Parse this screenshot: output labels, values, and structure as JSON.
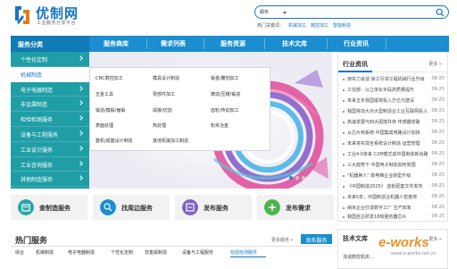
{
  "header": {
    "logo_name": "优制网",
    "logo_subtitle": "工业服务分享平台",
    "search_select": "服务",
    "search_placeholder": "",
    "hot_label": "热门关键词：",
    "hot_keywords": [
      "机械加工",
      "数控加工",
      "智能制造"
    ]
  },
  "nav": {
    "category_label": "服务分类",
    "items": [
      "服务商库",
      "需求列表",
      "服务资源",
      "技术文库",
      "行业资讯"
    ]
  },
  "categories": [
    "个性化定制",
    "机械制造",
    "电子电器制造",
    "非金属制造",
    "检验检测服务",
    "设备与工程服务",
    "工业设计服务",
    "工业咨询服务",
    "其他制造服务"
  ],
  "sub_menu": [
    "CNC数控加工",
    "模具设计制造",
    "钣金/雕刻加工",
    "五金工具",
    "零部件加工",
    "铸造/压铸/锻造",
    "锻造/模锻/锤锻",
    "焊接/切割",
    "齿轮/传动加工",
    "表面处理",
    "热处理",
    "粉末冶金",
    "整机/成套设计制造",
    "其他机械加工制造"
  ],
  "news": {
    "title": "行业资讯",
    "more": "更多 »",
    "items": [
      {
        "title": "用实力说话 徐工引领工程机械行业升级",
        "date": "08-25"
      },
      {
        "title": "工信部：以立体化手段抓质量提升",
        "date": "08-25"
      },
      {
        "title": "未来五年我国或将投入万亿元建设",
        "date": "08-25"
      },
      {
        "title": "我国将加大对大型制造业工业互联网投入",
        "date": "08-25"
      },
      {
        "title": "高速发展与四大困境并存 传感器突破",
        "date": "08-25"
      },
      {
        "title": "从芯片到系统:中国集成电路设计加快",
        "date": "08-25"
      },
      {
        "title": "未来将实现全系统设计制造 运营管理",
        "date": "08-25"
      },
      {
        "title": "工业4.0未来 C2M模式成中国制造新出路",
        "date": "08-25"
      },
      {
        "title": "三大趋势下 中国电子制造如何突围",
        "date": "08-25"
      },
      {
        "title": "\"机器换人\" 助电梯企业转型升级",
        "date": "08-25"
      },
      {
        "title": "《中国制造2025》 首批配套文件发布",
        "date": "08-25"
      },
      {
        "title": "未来5年，中国制造业机器人密度将",
        "date": "08-25"
      },
      {
        "title": "纳米企业打造数字工厂 生产效率",
        "date": "08-25"
      },
      {
        "title": "我国自主研发18核服务器芯片",
        "date": "08-25"
      }
    ]
  },
  "services": [
    "查制造服务",
    "找周边服务",
    "发布服务",
    "发布需求"
  ],
  "hot": {
    "title": "热门服务",
    "more": "更多服务 »",
    "publish": "发布服务",
    "tabs": [
      "综合",
      "机械制造",
      "电子电器制造",
      "个性化定制",
      "非金属制造",
      "设备与工程服务",
      "检验检测服务"
    ]
  },
  "tech": {
    "title": "技术文库",
    "more": "更多 »",
    "item": "浅谈数控机床..."
  },
  "watermark": {
    "brand": "e-works",
    "sub": "www.e-works.net.cn"
  }
}
